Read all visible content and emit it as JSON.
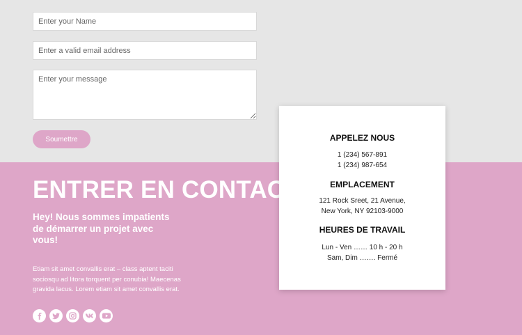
{
  "form": {
    "name_placeholder": "Enter your Name",
    "email_placeholder": "Enter a valid email address",
    "message_placeholder": "Enter your message",
    "submit_label": "Soumettre"
  },
  "contact": {
    "heading": "ENTRER EN CONTACT",
    "subheading": "Hey! Nous sommes impatients de démarrer un projet avec vous!",
    "body": "Etiam sit amet convallis erat – class aptent taciti sociosqu ad litora torquent per conubia! Maecenas gravida lacus. Lorem etiam sit amet convallis erat."
  },
  "social": [
    "facebook-icon",
    "twitter-icon",
    "instagram-icon",
    "vk-icon",
    "youtube-icon"
  ],
  "card": {
    "call_title": "APPELEZ NOUS",
    "phones": [
      "1 (234) 567-891",
      "1 (234) 987-654"
    ],
    "location_title": "EMPLACEMENT",
    "address": [
      "121 Rock Sreet, 21 Avenue,",
      "New York, NY 92103-9000"
    ],
    "hours_title": "HEURES DE TRAVAIL",
    "hours": [
      "Lun - Ven …… 10 h - 20 h",
      "Sam, Dim ……. Fermé"
    ]
  },
  "colors": {
    "accent": "#dea6c8",
    "background": "#e6e6e6"
  }
}
